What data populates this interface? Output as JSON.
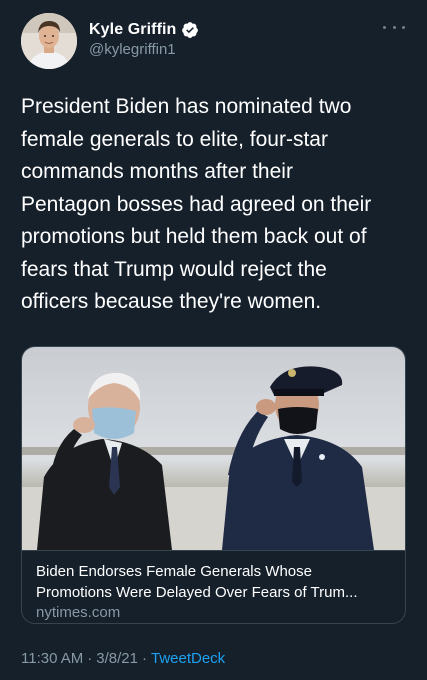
{
  "author": {
    "name": "Kyle Griffin",
    "handle": "@kylegriffin1",
    "verified": true,
    "avatar": "avatar-photo"
  },
  "tweet": {
    "text": "President Biden has nominated two\nfemale generals to elite, four-star\ncommands months after their\nPentagon bosses had agreed on their\npromotions but held them back out of\nfears that Trump would reject the\nofficers because they're women."
  },
  "card": {
    "image": "photo-biden-saluting-officer",
    "title": "Biden Endorses Female Generals Whose\nPromotions Were Delayed Over Fears of Trum...",
    "domain": "nytimes.com"
  },
  "meta": {
    "time": "11:30 AM",
    "separator": "·",
    "date": "3/8/21",
    "source": "TweetDeck"
  },
  "icons": {
    "more": "more-options-icon",
    "verified": "verified-badge-icon"
  },
  "colors": {
    "background": "#15202b",
    "secondary_text": "#8899a6",
    "link": "#1da1f2",
    "border": "#38444d"
  }
}
